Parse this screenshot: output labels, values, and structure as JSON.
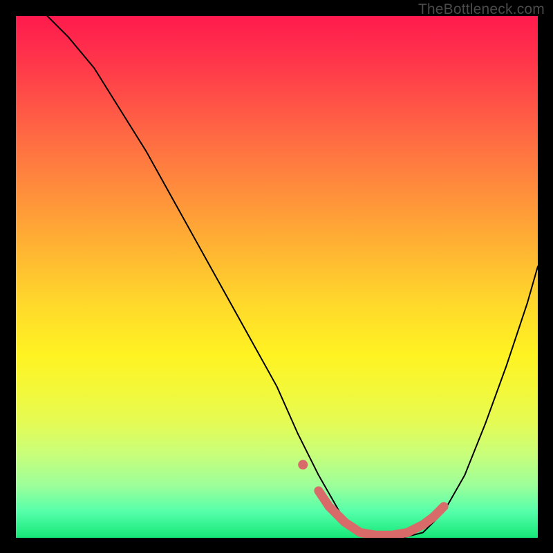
{
  "attribution": "TheBottleneck.com",
  "chart_data": {
    "type": "line",
    "title": "",
    "xlabel": "",
    "ylabel": "",
    "xlim": [
      0,
      100
    ],
    "ylim": [
      0,
      100
    ],
    "series": [
      {
        "name": "bottleneck-curve",
        "color": "#000000",
        "x": [
          6,
          10,
          15,
          20,
          25,
          30,
          35,
          40,
          45,
          50,
          54,
          58,
          62,
          66,
          70,
          74,
          78,
          82,
          86,
          90,
          94,
          98,
          100
        ],
        "y": [
          100,
          96,
          90,
          82,
          74,
          65,
          56,
          47,
          38,
          29,
          20,
          12,
          5,
          1,
          0,
          0,
          1,
          5,
          12,
          22,
          33,
          45,
          52
        ]
      },
      {
        "name": "highlight-segment",
        "color": "#d86a6a",
        "x": [
          58,
          60,
          63,
          66,
          69,
          72,
          75,
          78,
          80,
          82
        ],
        "y": [
          9,
          6,
          3,
          1,
          0.5,
          0.5,
          1,
          2.5,
          4,
          6
        ]
      },
      {
        "name": "highlight-dot",
        "color": "#d86a6a",
        "type": "scatter",
        "x": [
          55
        ],
        "y": [
          14
        ]
      }
    ]
  }
}
